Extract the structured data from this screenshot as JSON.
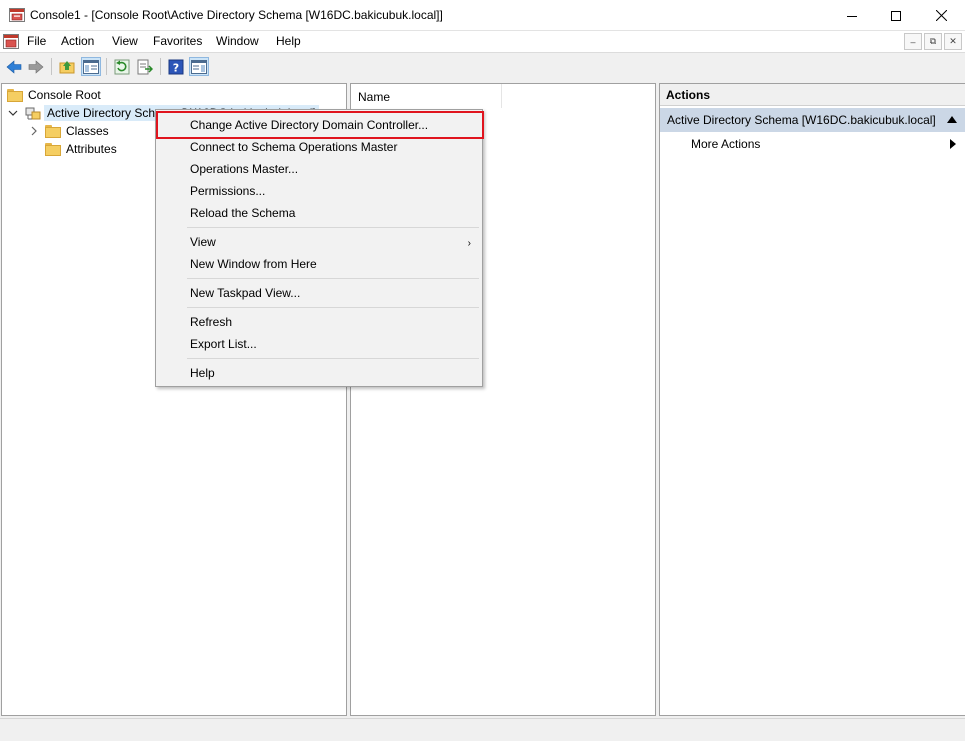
{
  "window": {
    "title": "Console1 - [Console Root\\Active Directory Schema [W16DC.bakicubuk.local]]",
    "icon": "mmc-console-icon",
    "minimize_icon": "minimize-icon",
    "maximize_icon": "maximize-icon",
    "close_icon": "close-icon"
  },
  "menubar": {
    "items": [
      "File",
      "Action",
      "View",
      "Favorites",
      "Window",
      "Help"
    ]
  },
  "toolbar": {
    "buttons": [
      "back-icon",
      "forward-icon",
      "up-folder-icon",
      "show-hide-tree-icon",
      "refresh-icon",
      "export-list-icon",
      "help-icon",
      "show-hide-action-pane-icon"
    ]
  },
  "tree": {
    "root_label": "Console Root",
    "schema_label": "Active Directory Schema [W16DC.bakicubuk.local]",
    "children": [
      "Classes",
      "Attributes"
    ]
  },
  "list": {
    "column_name": "Name"
  },
  "actions": {
    "header": "Actions",
    "group_title": "Active Directory Schema [W16DC.bakicubuk.local]",
    "more_actions": "More Actions"
  },
  "context_menu": {
    "items": [
      "Change Active Directory Domain Controller...",
      "Connect to Schema Operations Master",
      "Operations Master...",
      "Permissions...",
      "Reload the Schema",
      "View",
      "New Window from Here",
      "New Taskpad View...",
      "Refresh",
      "Export List...",
      "Help"
    ],
    "highlight_color": "#e0141e"
  }
}
